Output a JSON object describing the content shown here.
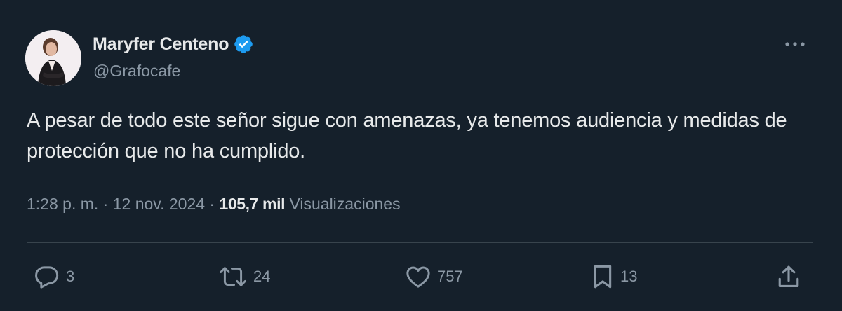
{
  "author": {
    "display_name": "Maryfer Centeno",
    "handle": "@Grafocafe",
    "verified": true,
    "verified_color": "#1d9bf0"
  },
  "tweet": {
    "text": "A pesar de todo este señor sigue con amenazas, ya tenemos audiencia y medidas de protección que no ha cumplido.",
    "time": "1:28 p. m.",
    "separator": "·",
    "date": "12 nov. 2024",
    "views_count": "105,7 mil",
    "views_label": "Visualizaciones"
  },
  "actions": {
    "replies": "3",
    "retweets": "24",
    "likes": "757",
    "bookmarks": "13"
  },
  "icons": {
    "more": "more-horizontal-icon",
    "reply": "reply-icon",
    "retweet": "retweet-icon",
    "like": "heart-icon",
    "bookmark": "bookmark-icon",
    "share": "share-icon"
  },
  "theme": {
    "background": "#15202b",
    "text": "#e7e9ea",
    "secondary_text": "#8b98a5",
    "divider": "#38444d"
  }
}
